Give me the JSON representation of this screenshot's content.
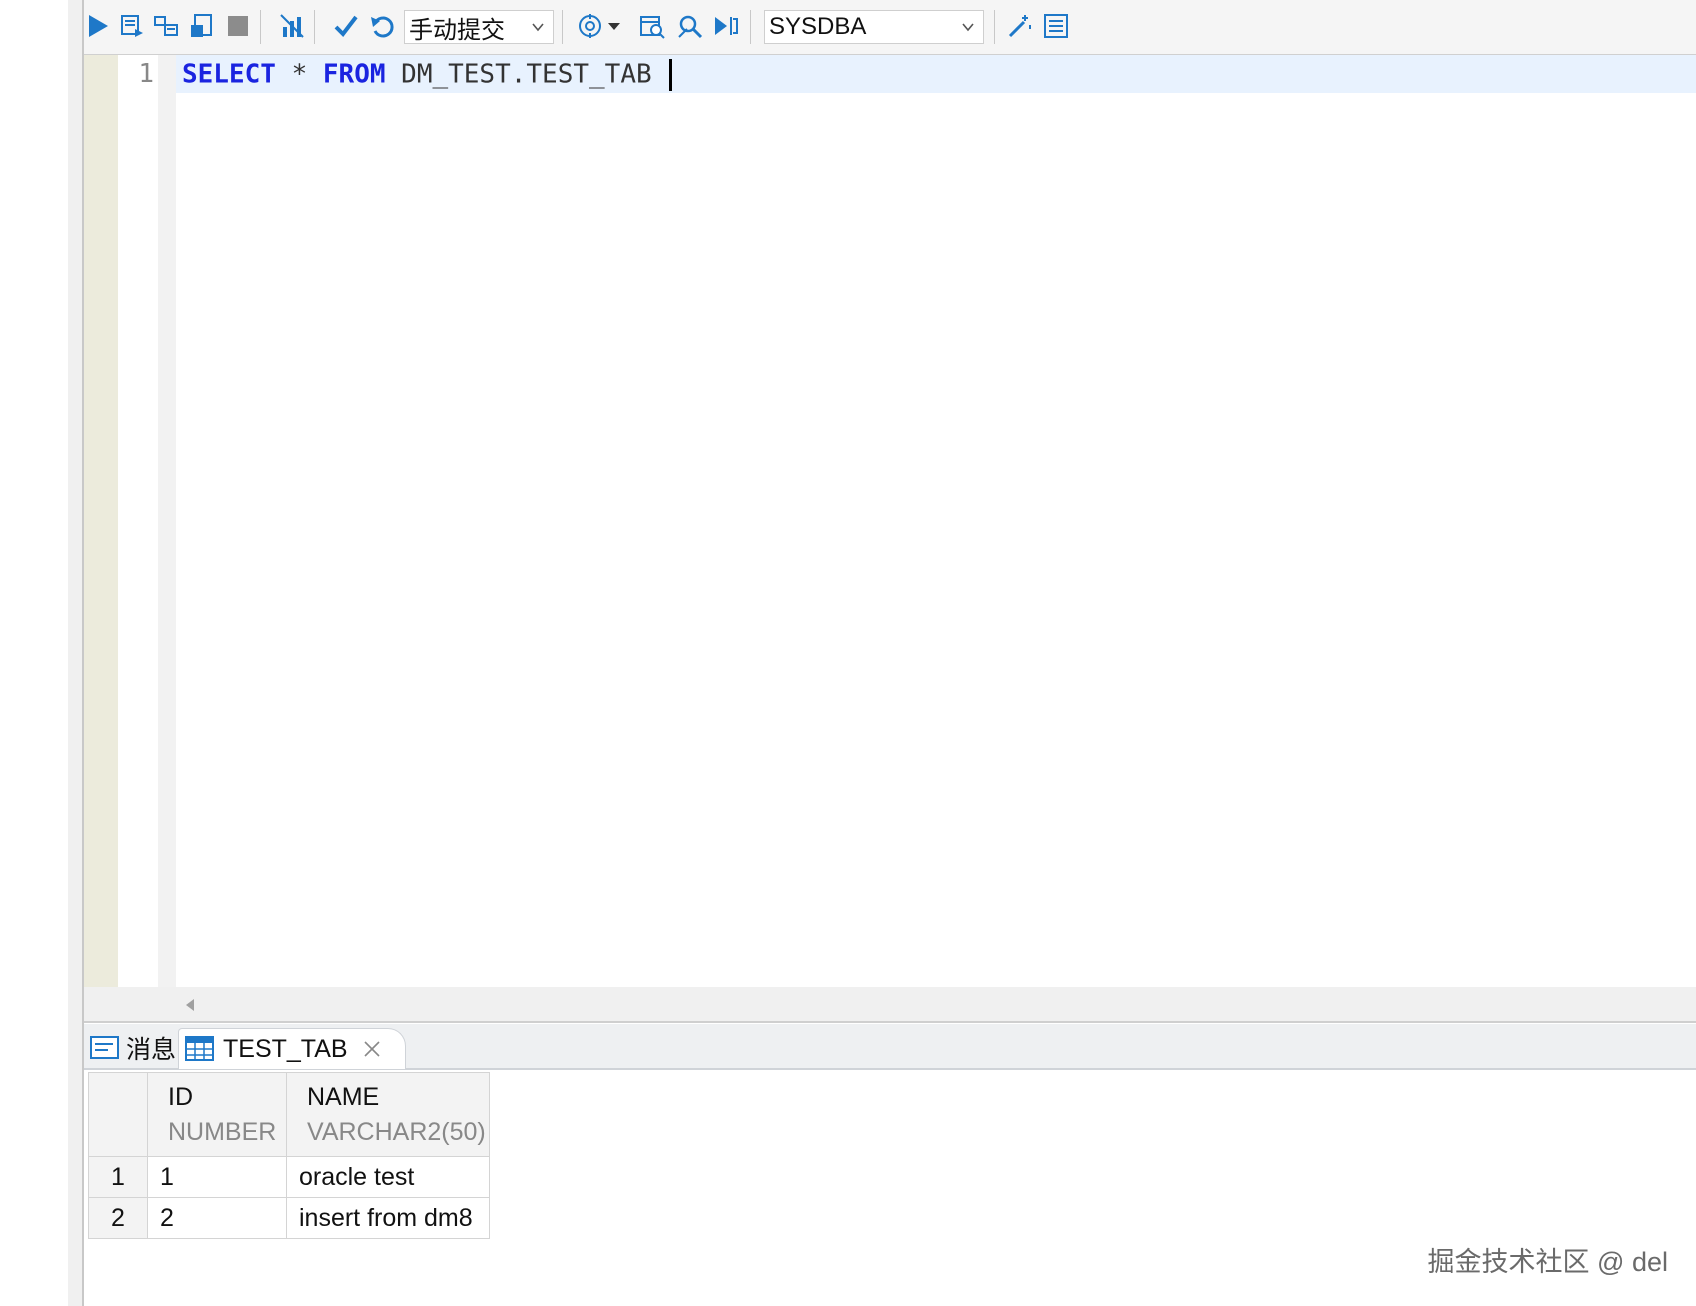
{
  "toolbar": {
    "commit_mode": "手动提交",
    "user": "SYSDBA",
    "icons": [
      "run-icon",
      "execute-script-icon",
      "explain-plan-icon",
      "export-icon",
      "stop-icon",
      "statistics-icon",
      "commit-icon",
      "rollback-icon",
      "target-icon",
      "calendar-search-icon",
      "search-icon",
      "step-icon",
      "magic-wand-icon",
      "list-icon"
    ]
  },
  "editor": {
    "line_numbers": [
      "1"
    ],
    "code": {
      "kw_select": "SELECT",
      "star": " * ",
      "kw_from": "FROM",
      "rest": " DM_TEST.TEST_TAB "
    }
  },
  "result_tabs": [
    {
      "label": "消息",
      "icon": "message-icon"
    },
    {
      "label": "TEST_TAB",
      "icon": "table-grid-icon",
      "closable": true
    }
  ],
  "result_grid": {
    "columns": [
      {
        "name": "ID",
        "type": "NUMBER"
      },
      {
        "name": "NAME",
        "type": "VARCHAR2(50)"
      }
    ],
    "rows": [
      {
        "num": "1",
        "cells": [
          "1",
          "oracle test"
        ]
      },
      {
        "num": "2",
        "cells": [
          "2",
          "insert from dm8"
        ]
      }
    ]
  },
  "watermark": "掘金技术社区 @ del",
  "colors": {
    "keyword": "#1a24e0",
    "toolbar_icon": "#1e78c8",
    "current_line": "#e8f2fe"
  }
}
